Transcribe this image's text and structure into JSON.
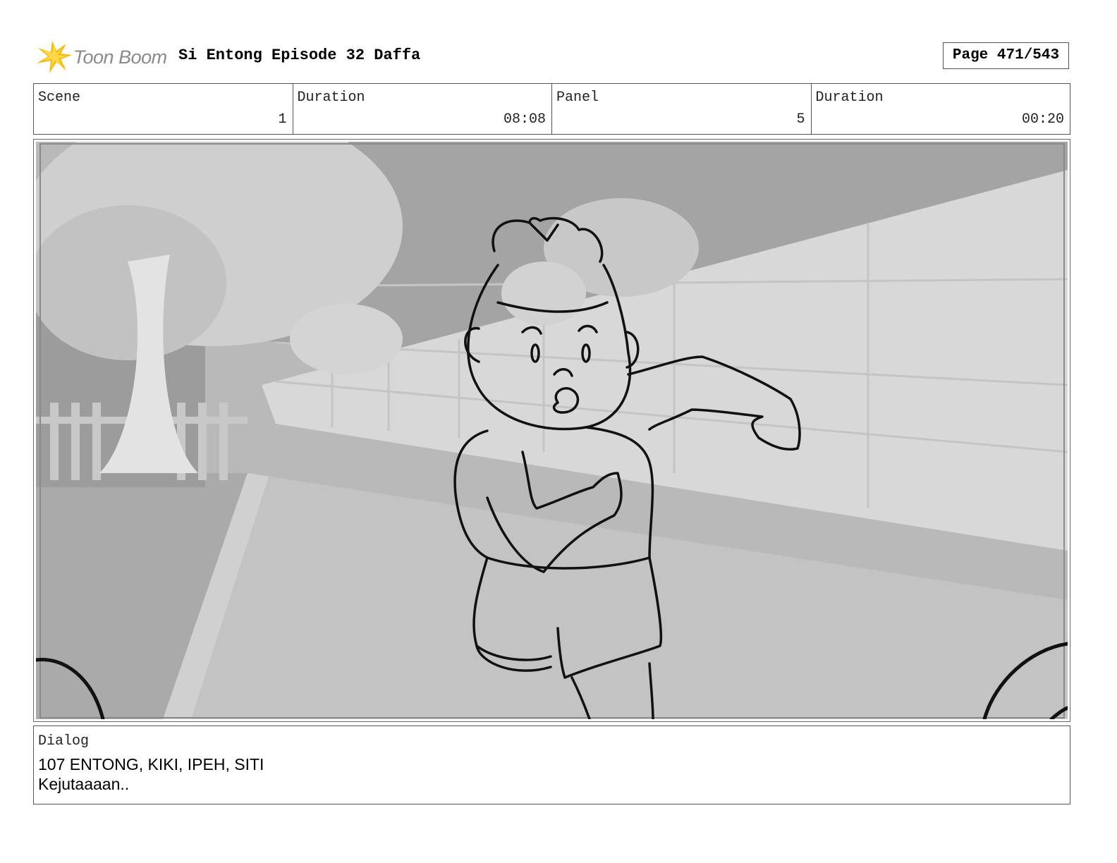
{
  "header": {
    "brand": "Toon Boom",
    "title": "Si Entong Episode 32 Daffa",
    "page": "Page 471/543"
  },
  "info": {
    "scene_label": "Scene",
    "scene_value": "1",
    "duration_label": "Duration",
    "duration_value": "08:08",
    "panel_label": "Panel",
    "panel_value": "5",
    "panel_duration_label": "Duration",
    "panel_duration_value": "00:20"
  },
  "dialog": {
    "label": "Dialog",
    "line1": "107 ENTONG, KIKI, IPEH, SITI",
    "line2": "Kejutaaaan.."
  },
  "colors": {
    "logo_star": "#f5b800",
    "logo_text": "#8a8a8a",
    "frame": "#555555"
  }
}
